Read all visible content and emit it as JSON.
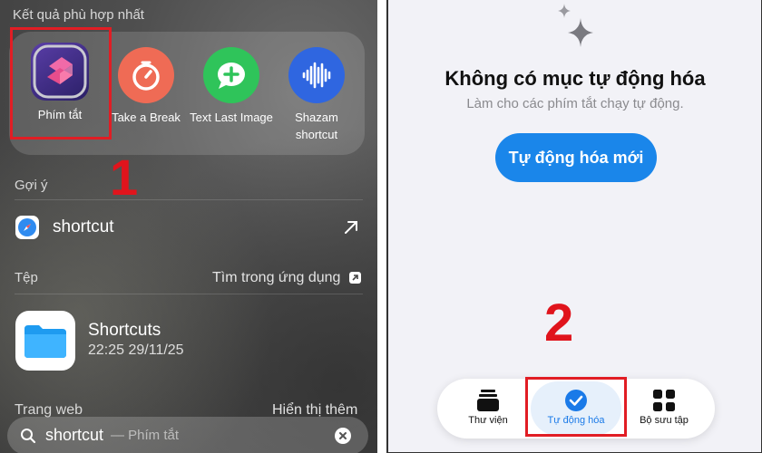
{
  "left_panel": {
    "top_hits_title": "Kết quả phù hợp nhất",
    "apps": [
      {
        "label": "Phím tắt",
        "icon": "shortcuts-icon"
      },
      {
        "label": "Take a Break",
        "icon": "timer-icon"
      },
      {
        "label": "Text Last Image",
        "icon": "message-plus-icon"
      },
      {
        "label": "Shazam shortcut",
        "icon": "waveform-icon"
      }
    ],
    "step_number": "1",
    "suggestions_title": "Gợi ý",
    "suggestion": {
      "text": "shortcut",
      "icon": "safari-icon"
    },
    "files_title": "Tệp",
    "files_link": "Tìm trong ứng dụng",
    "file": {
      "name": "Shortcuts",
      "meta": "22:25 29/11/25"
    },
    "web_title": "Trang web",
    "web_link": "Hiển thị thêm",
    "search": {
      "query": "shortcut",
      "hint": "— Phím tắt"
    }
  },
  "right_panel": {
    "title": "Không có mục tự động hóa",
    "subtitle": "Làm cho các phím tắt chạy tự động.",
    "button_label": "Tự động hóa mới",
    "step_number": "2",
    "tabs": [
      {
        "label": "Thư viện",
        "icon": "library-icon",
        "active": false
      },
      {
        "label": "Tự động hóa",
        "icon": "automation-check-icon",
        "active": true
      },
      {
        "label": "Bộ sưu tập",
        "icon": "grid-icon",
        "active": false
      }
    ]
  },
  "colors": {
    "highlight": "#e11d24",
    "accent": "#1a86ea"
  }
}
